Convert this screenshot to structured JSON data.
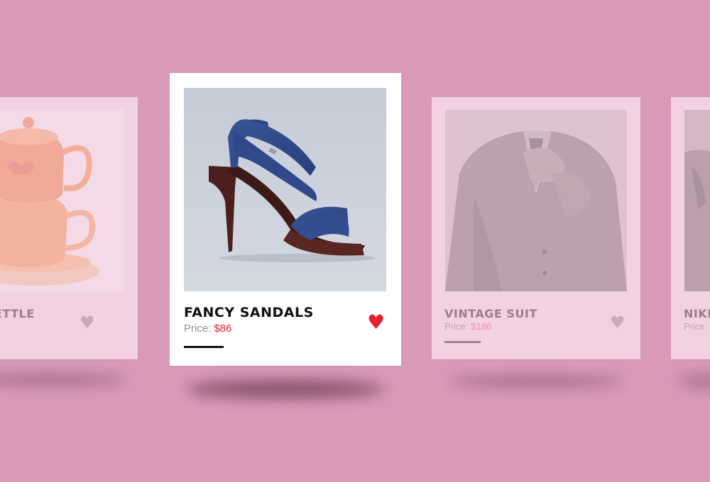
{
  "products": [
    {
      "id": "kettle",
      "title": "KETTLE",
      "liked": false
    },
    {
      "id": "sandals",
      "title": "FANCY SANDALS",
      "price_label": "Price:",
      "price_value": "$86",
      "liked": true
    },
    {
      "id": "suit",
      "title": "VINTAGE SUIT",
      "price_label": "Price:",
      "price_value": "$186",
      "liked": false
    },
    {
      "id": "nike",
      "title": "NIKE",
      "price_label": "Price"
    }
  ],
  "icons": {
    "heart": "heart-icon"
  },
  "colors": {
    "background": "#d99aba",
    "accent_red": "#e5212f",
    "price_red": "#e7213b"
  }
}
